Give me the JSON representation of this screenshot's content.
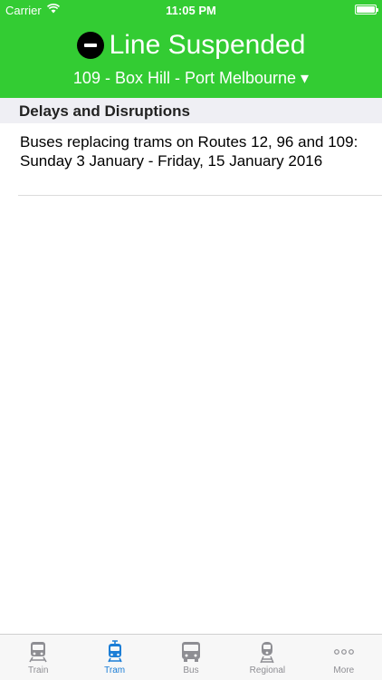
{
  "status_bar": {
    "carrier": "Carrier",
    "time": "11:05 PM"
  },
  "header": {
    "status_title": "Line Suspended",
    "route_label": "109 - Box Hill - Port Melbourne ▾",
    "background_color": "#33cc33"
  },
  "section": {
    "title": "Delays and Disruptions"
  },
  "disruptions": [
    {
      "text": "Buses replacing trams on Routes 12, 96 and 109: Sunday 3 January - Friday, 15 January 2016"
    }
  ],
  "tabbar": {
    "active_color": "#1c7ed6",
    "items": [
      {
        "label": "Train",
        "icon": "train-icon"
      },
      {
        "label": "Tram",
        "icon": "tram-icon",
        "active": true
      },
      {
        "label": "Bus",
        "icon": "bus-icon"
      },
      {
        "label": "Regional",
        "icon": "regional-train-icon"
      },
      {
        "label": "More",
        "icon": "more-icon"
      }
    ]
  }
}
